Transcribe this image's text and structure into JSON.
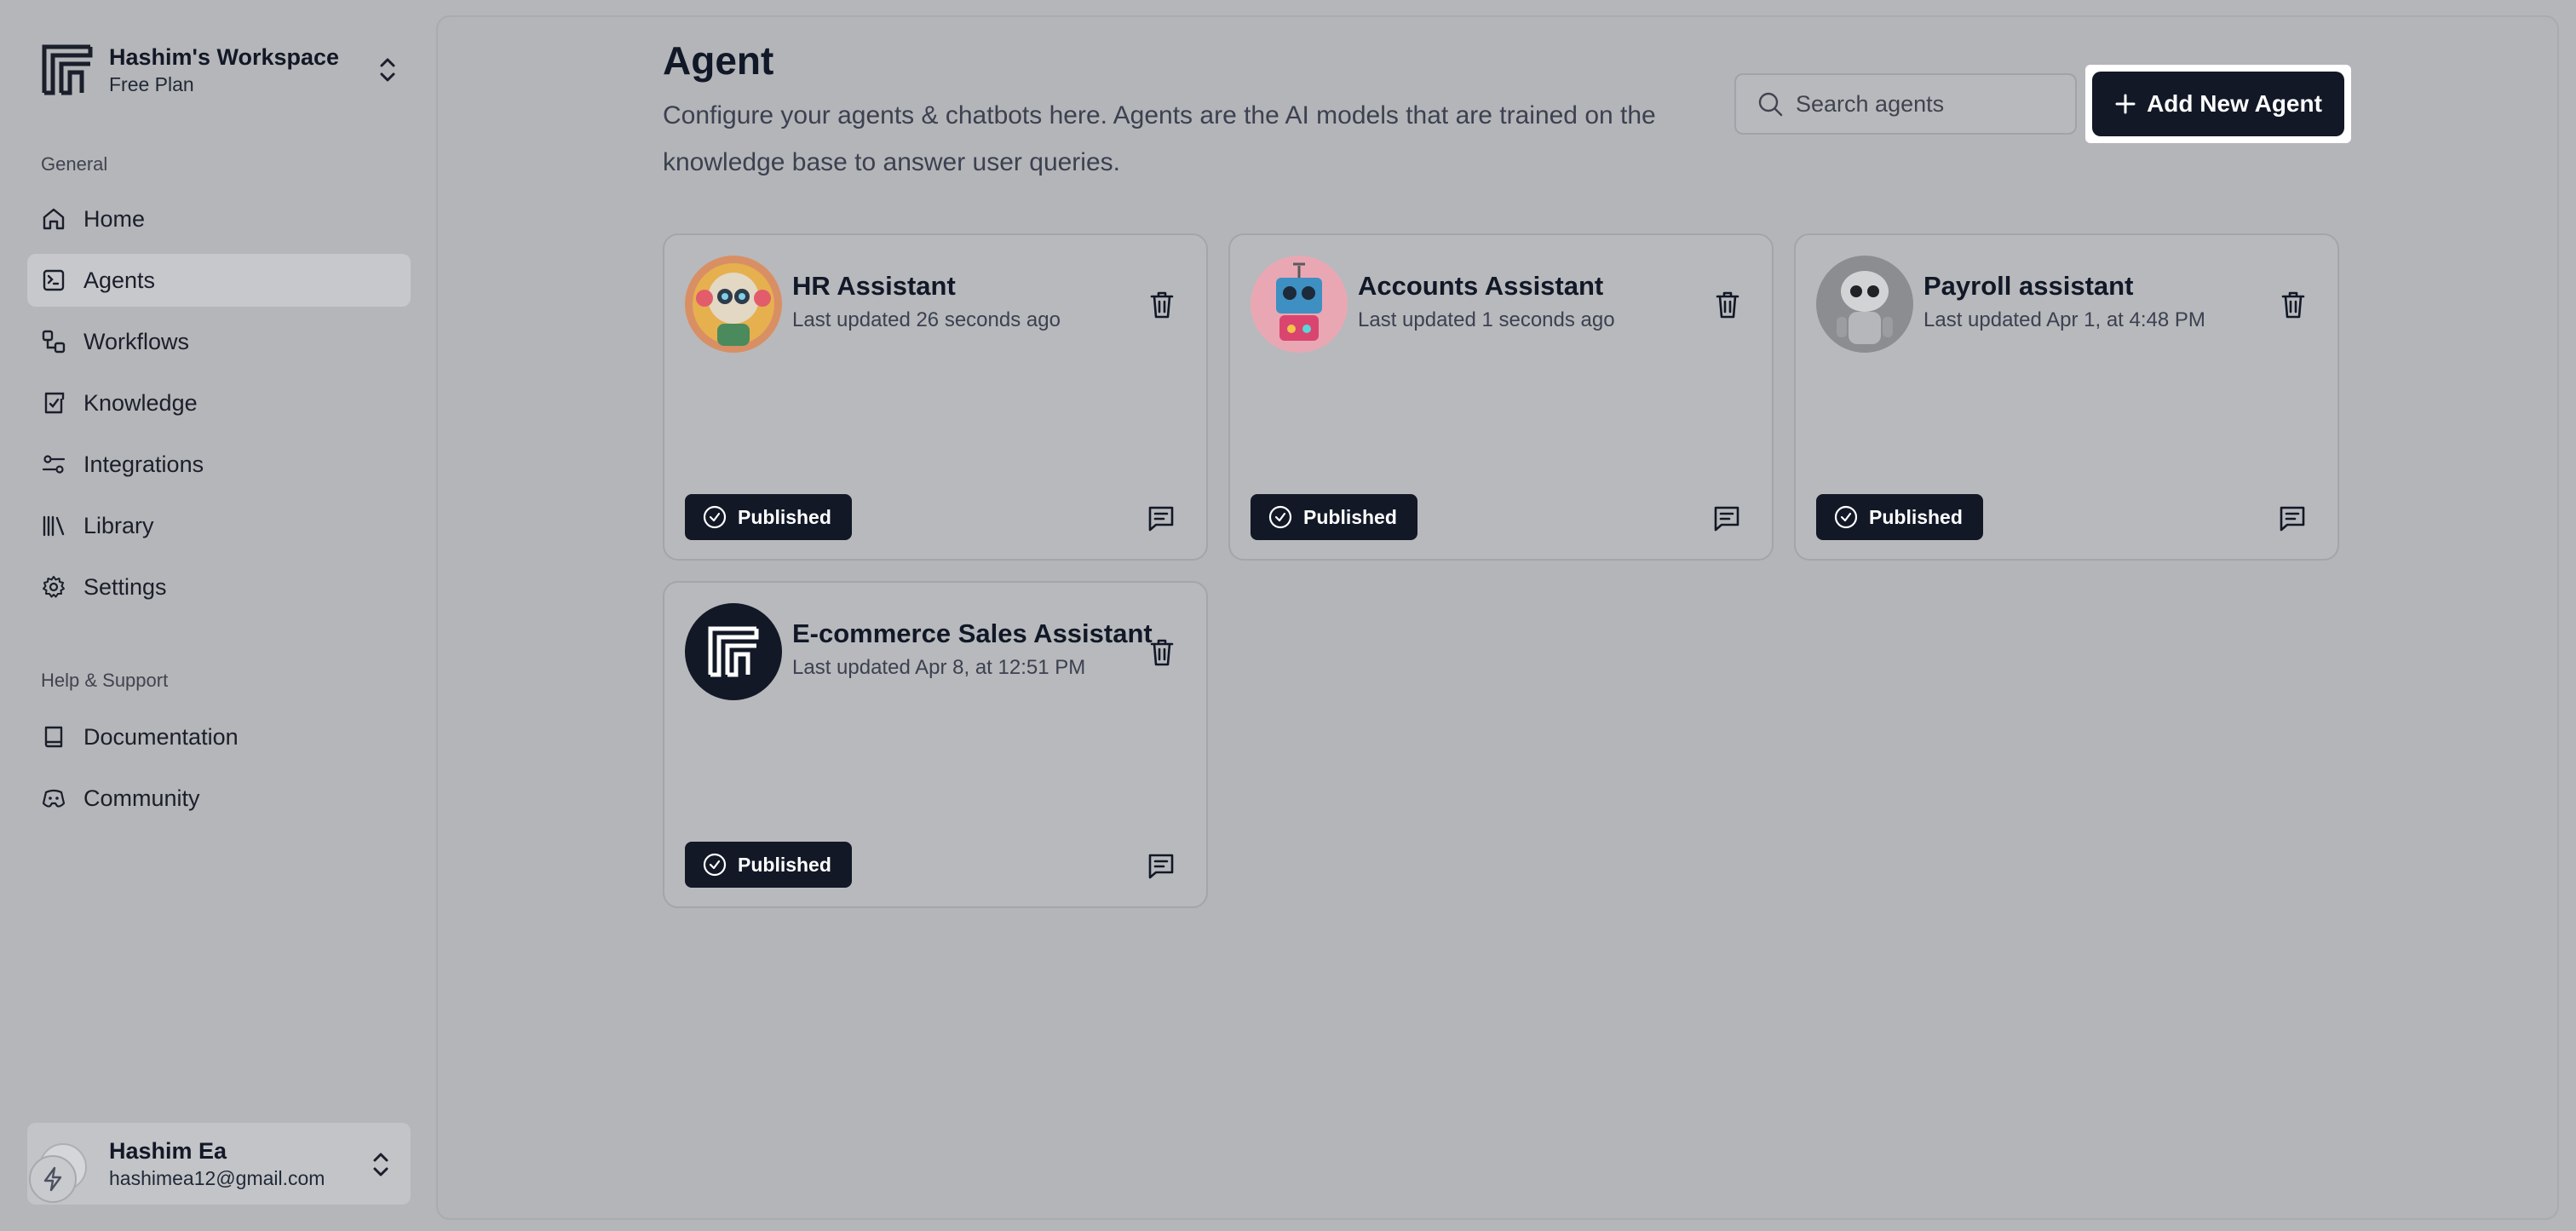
{
  "workspace": {
    "name": "Hashim's Workspace",
    "plan": "Free Plan"
  },
  "sidebar": {
    "general_label": "General",
    "items": [
      {
        "label": "Home",
        "icon": "home-icon"
      },
      {
        "label": "Agents",
        "icon": "agents-icon",
        "active": true
      },
      {
        "label": "Workflows",
        "icon": "workflows-icon"
      },
      {
        "label": "Knowledge",
        "icon": "knowledge-icon"
      },
      {
        "label": "Integrations",
        "icon": "integrations-icon"
      },
      {
        "label": "Library",
        "icon": "library-icon"
      },
      {
        "label": "Settings",
        "icon": "gear-icon"
      }
    ],
    "help_label": "Help & Support",
    "help_items": [
      {
        "label": "Documentation",
        "icon": "book-icon"
      },
      {
        "label": "Community",
        "icon": "discord-icon"
      }
    ]
  },
  "user": {
    "name": "Hashim Ea",
    "email": "hashimea12@gmail.com"
  },
  "page": {
    "title": "Agent",
    "description": "Configure your agents & chatbots here. Agents are the AI models that are trained on the knowledge base to answer user queries."
  },
  "search": {
    "placeholder": "Search agents",
    "value": ""
  },
  "add_button_label": "Add New Agent",
  "agents": [
    {
      "name": "HR Assistant",
      "updated": "Last updated 26 seconds ago",
      "status": "Published",
      "avatar": "robot-orange-avatar"
    },
    {
      "name": "Accounts Assistant",
      "updated": "Last updated 1 seconds ago",
      "status": "Published",
      "avatar": "robot-blue-avatar"
    },
    {
      "name": "Payroll assistant",
      "updated": "Last updated Apr 1, at 4:48 PM",
      "status": "Published",
      "avatar": "robot-grey-avatar"
    },
    {
      "name": "E-commerce Sales Assistant",
      "updated": "Last updated Apr 8, at 12:51 PM",
      "status": "Published",
      "avatar": "logo-avatar"
    }
  ],
  "colors": {
    "primary": "#121826",
    "background": "#b5b6b9",
    "highlight": "#ffffff"
  }
}
